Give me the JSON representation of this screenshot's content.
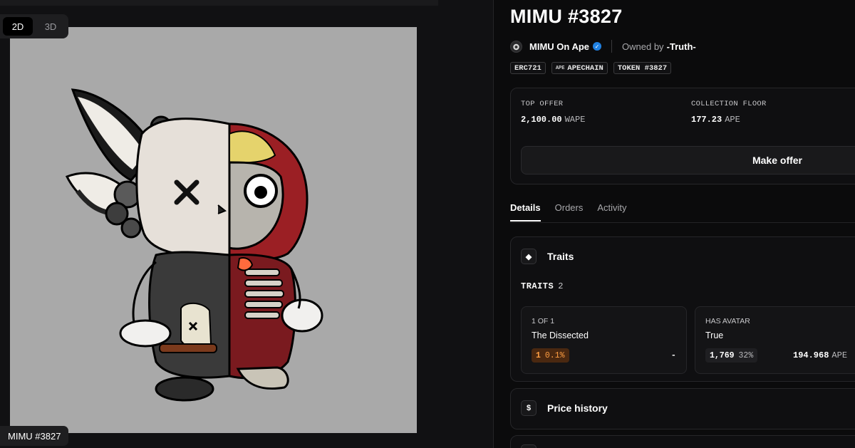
{
  "media": {
    "view_modes": [
      {
        "label": "2D",
        "active": true
      },
      {
        "label": "3D",
        "active": false
      }
    ],
    "caption": "MIMU #3827",
    "background_color": "#a9a9a9"
  },
  "item": {
    "title": "MIMU #3827",
    "collection_name": "MIMU On Ape",
    "verified": true,
    "owned_by_label": "Owned by",
    "owner": "-Truth-",
    "tags": [
      {
        "label": "ERC721",
        "icon": null
      },
      {
        "label": "APECHAIN",
        "icon": "ape-icon",
        "icon_text": "APE"
      },
      {
        "label": "TOKEN #3827",
        "icon": null
      }
    ]
  },
  "offers": {
    "top_offer_label": "TOP OFFER",
    "top_offer_value": "2,100.00",
    "top_offer_unit": "WAPE",
    "floor_label": "COLLECTION FLOOR",
    "floor_value": "177.23",
    "floor_unit": "APE",
    "make_offer_label": "Make offer"
  },
  "tabs": [
    {
      "label": "Details",
      "active": true
    },
    {
      "label": "Orders",
      "active": false
    },
    {
      "label": "Activity",
      "active": false
    }
  ],
  "traits": {
    "section_title": "Traits",
    "count_label": "TRAITS",
    "count": "2",
    "items": [
      {
        "type": "1 OF 1",
        "value": "The Dissected",
        "count": "1",
        "percent": "0.1%",
        "price": "-",
        "price_unit": "",
        "rare": true
      },
      {
        "type": "HAS AVATAR",
        "value": "True",
        "count": "1,769",
        "percent": "32%",
        "price": "194.968",
        "price_unit": "APE",
        "rare": false
      }
    ]
  },
  "price_history": {
    "title": "Price history",
    "icon": "dollar-icon"
  },
  "colors": {
    "accent_verified": "#2081e2",
    "rare_badge_bg": "#4a2810",
    "rare_badge_fg": "#ff9f43",
    "page_bg": "#0b0b0c"
  }
}
